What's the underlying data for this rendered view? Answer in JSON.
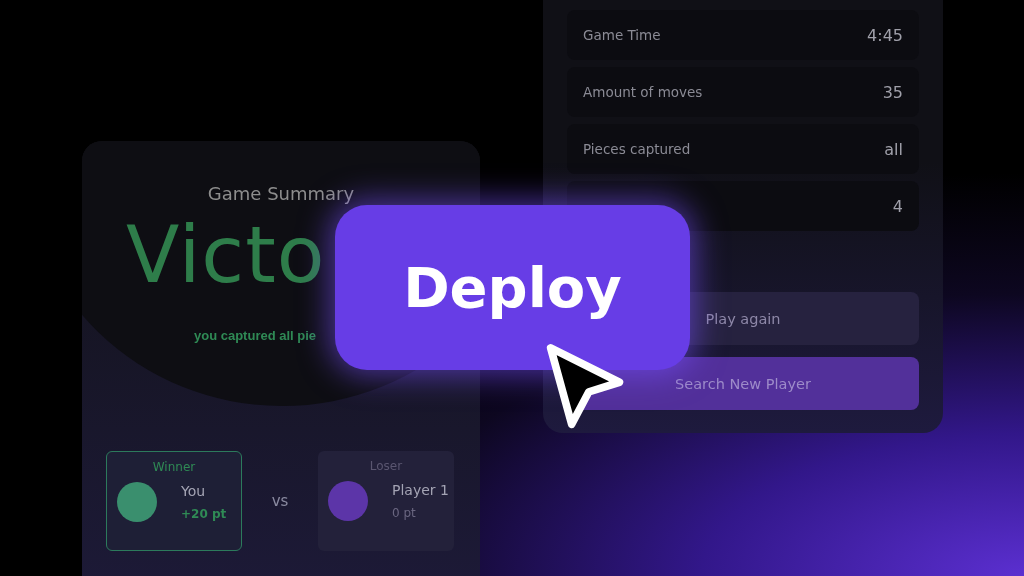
{
  "summary_card": {
    "title": "Game Summary",
    "result": "Victo",
    "message": "you captured all pie",
    "players": [
      {
        "role": "Winner",
        "name": "You",
        "points": "+20 pt",
        "selected": true,
        "color": "#3a8f6e"
      },
      {
        "role": "Loser",
        "name": "Player 1",
        "points": "0 pt",
        "selected": false,
        "color": "#5c35a8"
      }
    ],
    "versus": "vs"
  },
  "stats_card": {
    "rows": [
      {
        "label": "Game Time",
        "value": "4:45"
      },
      {
        "label": "Amount of moves",
        "value": "35"
      },
      {
        "label": "Pieces captured",
        "value": "all"
      },
      {
        "value": "4"
      }
    ],
    "buttons": [
      {
        "label": "Play again",
        "kind": "secondary"
      },
      {
        "label": "Search New Player",
        "kind": "primary"
      }
    ]
  },
  "deploy_button": {
    "label": "Deploy"
  }
}
